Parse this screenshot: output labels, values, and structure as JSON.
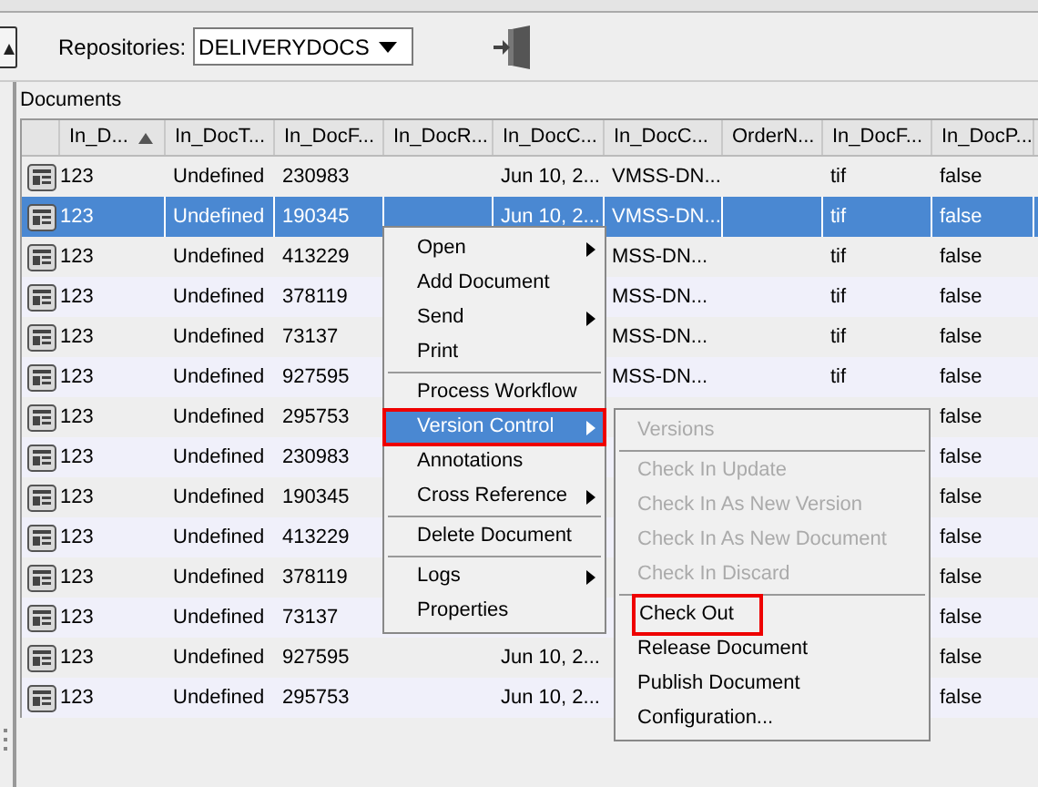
{
  "toolbar": {
    "repositories_label": "Repositories:",
    "repository": "DELIVERYDOCS"
  },
  "documents_label": "Documents",
  "table": {
    "columns": [
      {
        "label": "In_D...",
        "sorted": true
      },
      {
        "label": "In_DocT...",
        "sorted": false
      },
      {
        "label": "In_DocF...",
        "sorted": false
      },
      {
        "label": "In_DocR...",
        "sorted": false
      },
      {
        "label": "In_DocC...",
        "sorted": false
      },
      {
        "label": "In_DocC...",
        "sorted": false
      },
      {
        "label": "OrderN...",
        "sorted": false
      },
      {
        "label": "In_DocF...",
        "sorted": false
      },
      {
        "label": "In_DocP...",
        "sorted": false
      }
    ],
    "rows": [
      {
        "selected": false,
        "cells": [
          "123",
          "Undefined",
          "230983",
          null,
          "Jun 10, 2...",
          "VMSS-DN...",
          null,
          "tif",
          "false"
        ]
      },
      {
        "selected": true,
        "cells": [
          "123",
          "Undefined",
          "190345",
          null,
          "Jun 10, 2...",
          "VMSS-DN...",
          null,
          "tif",
          "false"
        ]
      },
      {
        "selected": false,
        "cells": [
          "123",
          "Undefined",
          "413229",
          null,
          null,
          "MSS-DN...",
          null,
          "tif",
          "false"
        ]
      },
      {
        "selected": false,
        "cells": [
          "123",
          "Undefined",
          "378119",
          null,
          null,
          "MSS-DN...",
          null,
          "tif",
          "false"
        ]
      },
      {
        "selected": false,
        "cells": [
          "123",
          "Undefined",
          "73137",
          null,
          null,
          "MSS-DN...",
          null,
          "tif",
          "false"
        ]
      },
      {
        "selected": false,
        "cells": [
          "123",
          "Undefined",
          "927595",
          null,
          null,
          "MSS-DN...",
          null,
          "tif",
          "false"
        ]
      },
      {
        "selected": false,
        "cells": [
          "123",
          "Undefined",
          "295753",
          null,
          null,
          null,
          null,
          null,
          "false"
        ]
      },
      {
        "selected": false,
        "cells": [
          "123",
          "Undefined",
          "230983",
          null,
          null,
          null,
          null,
          null,
          "false"
        ]
      },
      {
        "selected": false,
        "cells": [
          "123",
          "Undefined",
          "190345",
          null,
          null,
          null,
          null,
          null,
          "false"
        ]
      },
      {
        "selected": false,
        "cells": [
          "123",
          "Undefined",
          "413229",
          null,
          null,
          null,
          null,
          null,
          "false"
        ]
      },
      {
        "selected": false,
        "cells": [
          "123",
          "Undefined",
          "378119",
          null,
          null,
          null,
          null,
          null,
          "false"
        ]
      },
      {
        "selected": false,
        "cells": [
          "123",
          "Undefined",
          "73137",
          null,
          null,
          null,
          null,
          null,
          "false"
        ]
      },
      {
        "selected": false,
        "cells": [
          "123",
          "Undefined",
          "927595",
          null,
          "Jun 10, 2...",
          null,
          null,
          null,
          "false"
        ]
      },
      {
        "selected": false,
        "cells": [
          "123",
          "Undefined",
          "295753",
          null,
          "Jun 10, 2...",
          null,
          null,
          null,
          "false"
        ]
      }
    ]
  },
  "context_menu": [
    {
      "kind": "item",
      "label": "Open",
      "submenu": true,
      "selected": false,
      "annotated": false
    },
    {
      "kind": "item",
      "label": "Add Document",
      "submenu": false,
      "selected": false,
      "annotated": false
    },
    {
      "kind": "item",
      "label": "Send",
      "submenu": true,
      "selected": false,
      "annotated": false
    },
    {
      "kind": "item",
      "label": "Print",
      "submenu": false,
      "selected": false,
      "annotated": false
    },
    {
      "kind": "separator"
    },
    {
      "kind": "item",
      "label": "Process Workflow",
      "submenu": false,
      "selected": false,
      "annotated": false
    },
    {
      "kind": "item",
      "label": "Version Control",
      "submenu": true,
      "selected": true,
      "annotated": true
    },
    {
      "kind": "item",
      "label": "Annotations",
      "submenu": false,
      "selected": false,
      "annotated": false
    },
    {
      "kind": "item",
      "label": "Cross Reference",
      "submenu": true,
      "selected": false,
      "annotated": false
    },
    {
      "kind": "separator"
    },
    {
      "kind": "item",
      "label": "Delete Document",
      "submenu": false,
      "selected": false,
      "annotated": false
    },
    {
      "kind": "separator"
    },
    {
      "kind": "item",
      "label": "Logs",
      "submenu": true,
      "selected": false,
      "annotated": false
    },
    {
      "kind": "item",
      "label": "Properties",
      "submenu": false,
      "selected": false,
      "annotated": false
    }
  ],
  "submenu": [
    {
      "kind": "item",
      "label": "Versions",
      "disabled": true,
      "annotated": false
    },
    {
      "kind": "separator"
    },
    {
      "kind": "item",
      "label": "Check In Update",
      "disabled": true,
      "annotated": false
    },
    {
      "kind": "item",
      "label": "Check In As New Version",
      "disabled": true,
      "annotated": false
    },
    {
      "kind": "item",
      "label": "Check In As New Document",
      "disabled": true,
      "annotated": false
    },
    {
      "kind": "item",
      "label": "Check In Discard",
      "disabled": true,
      "annotated": false
    },
    {
      "kind": "separator"
    },
    {
      "kind": "item",
      "label": "Check Out",
      "disabled": false,
      "annotated": true
    },
    {
      "kind": "item",
      "label": "Release Document",
      "disabled": false,
      "annotated": false
    },
    {
      "kind": "item",
      "label": "Publish Document",
      "disabled": false,
      "annotated": false
    },
    {
      "kind": "item",
      "label": "Configuration...",
      "disabled": false,
      "annotated": false
    }
  ]
}
